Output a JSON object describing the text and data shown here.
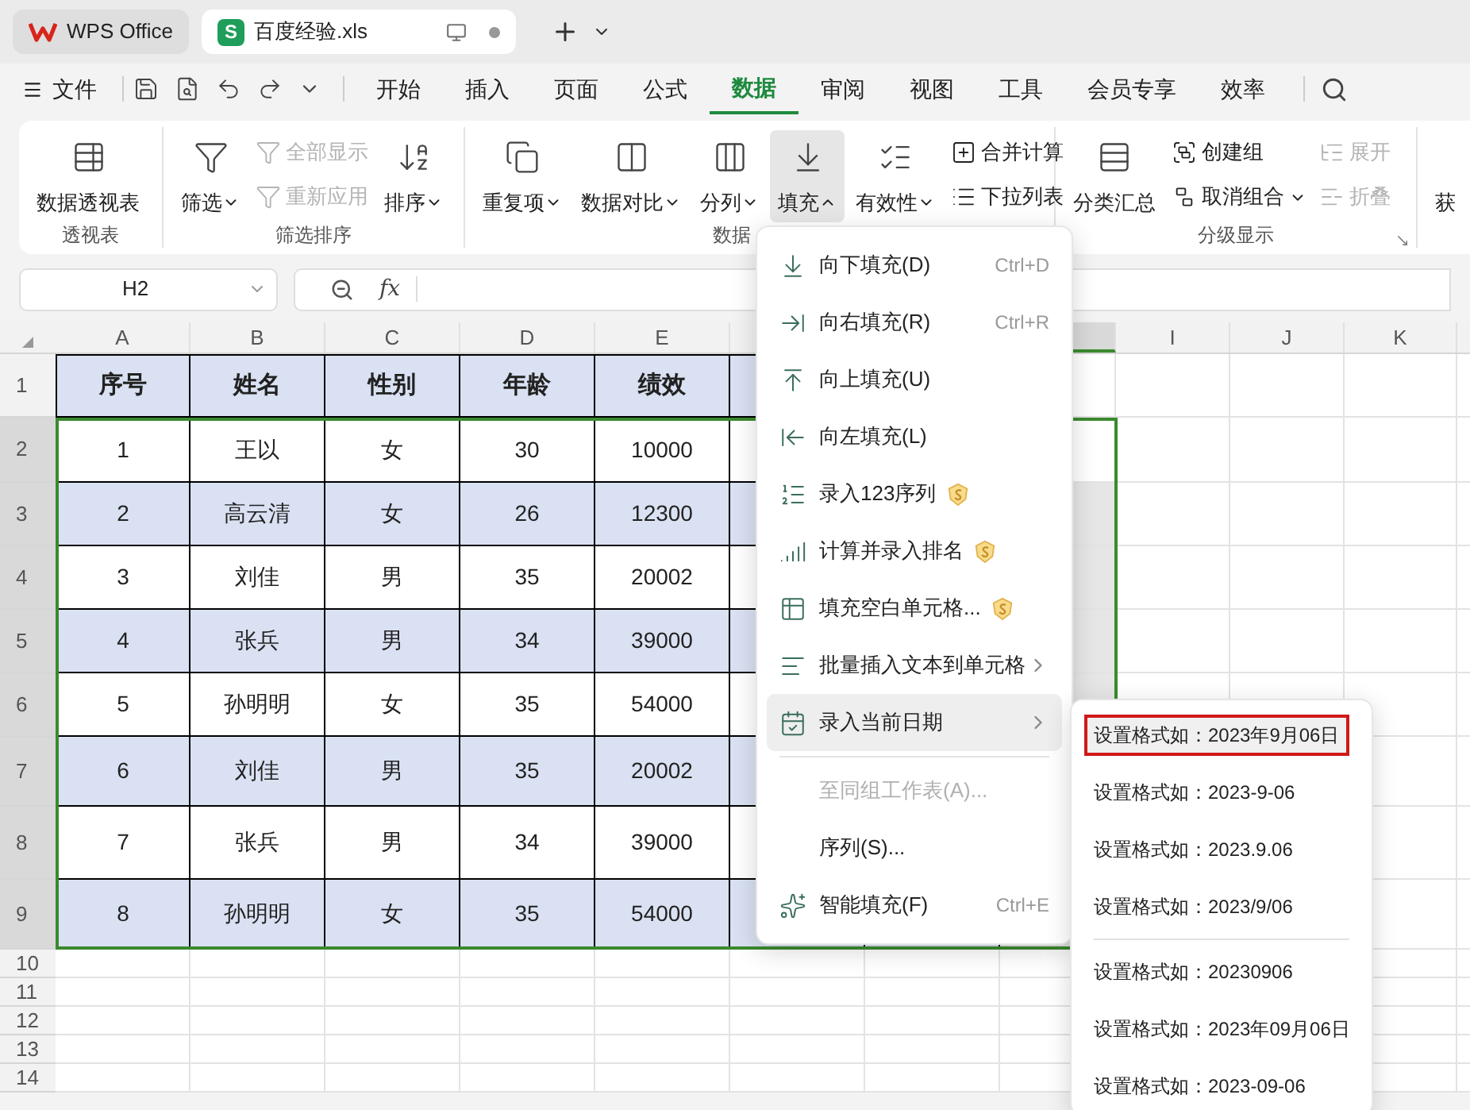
{
  "tabs": [
    {
      "label": "WPS Office",
      "kind": "home",
      "selected": false
    },
    {
      "label": "百度经验.xls",
      "kind": "sheet",
      "badge": "S",
      "selected": true
    }
  ],
  "file_menu": "文件",
  "menu_tabs": [
    {
      "label": "开始",
      "selected": false
    },
    {
      "label": "插入",
      "selected": false
    },
    {
      "label": "页面",
      "selected": false
    },
    {
      "label": "公式",
      "selected": false
    },
    {
      "label": "数据",
      "selected": true
    },
    {
      "label": "审阅",
      "selected": false
    },
    {
      "label": "视图",
      "selected": false
    },
    {
      "label": "工具",
      "selected": false
    },
    {
      "label": "会员专享",
      "selected": false
    },
    {
      "label": "效率",
      "selected": false
    }
  ],
  "ribbon": {
    "groups": [
      {
        "label": "透视表",
        "items": [
          {
            "kind": "large",
            "label": "数据透视表",
            "selected": false
          }
        ]
      },
      {
        "label": "筛选排序",
        "items": [
          {
            "kind": "large",
            "label": "筛选",
            "dropdown": true,
            "expanded": false,
            "selected": false
          },
          {
            "kind": "stack",
            "items": [
              {
                "label": "全部显示",
                "disabled": true
              },
              {
                "label": "重新应用",
                "disabled": true
              }
            ]
          },
          {
            "kind": "large",
            "label": "排序",
            "dropdown": true,
            "expanded": false,
            "selected": false
          }
        ]
      },
      {
        "label": "数据",
        "items": [
          {
            "kind": "large",
            "label": "重复项",
            "dropdown": true,
            "expanded": false,
            "selected": false
          },
          {
            "kind": "large",
            "label": "数据对比",
            "dropdown": true,
            "expanded": false,
            "selected": false
          },
          {
            "kind": "large",
            "label": "分列",
            "dropdown": true,
            "expanded": false,
            "selected": false
          },
          {
            "kind": "large",
            "label": "填充",
            "dropdown": true,
            "expanded": true,
            "selected": true
          },
          {
            "kind": "large",
            "label": "有效性",
            "dropdown": true,
            "expanded": false,
            "selected": false
          },
          {
            "kind": "stack",
            "items": [
              {
                "label": "合并计算",
                "disabled": false
              },
              {
                "label": "下拉列表",
                "disabled": false
              }
            ]
          }
        ]
      },
      {
        "label": "分级显示",
        "launcher": true,
        "items": [
          {
            "kind": "large",
            "label": "分类汇总",
            "selected": false
          },
          {
            "kind": "stack",
            "items": [
              {
                "label": "创建组",
                "disabled": false
              },
              {
                "label": "取消组合",
                "disabled": false,
                "dropdown": true,
                "expanded": false
              }
            ]
          },
          {
            "kind": "stack",
            "items": [
              {
                "label": "展开",
                "disabled": true
              },
              {
                "label": "折叠",
                "disabled": true
              }
            ]
          }
        ]
      },
      {
        "items": [
          {
            "kind": "large",
            "label": "获",
            "selected": false
          }
        ]
      }
    ]
  },
  "formula_bar": {
    "cell_ref": "H2",
    "fx": "fx"
  },
  "grid": {
    "columns": [
      {
        "label": "A",
        "selected": false
      },
      {
        "label": "B",
        "selected": false
      },
      {
        "label": "C",
        "selected": false
      },
      {
        "label": "D",
        "selected": false
      },
      {
        "label": "E",
        "selected": false
      },
      {
        "selected": true
      },
      {
        "label": "I",
        "selected": false
      },
      {
        "label": "J",
        "selected": false
      },
      {
        "label": "K",
        "selected": false
      }
    ],
    "rows": [
      {
        "label": "1",
        "selected": false,
        "cells": [
          "序号",
          "姓名",
          "性别",
          "年龄",
          "绩效"
        ]
      },
      {
        "label": "2",
        "selected": true,
        "cells": [
          "1",
          "王以",
          "女",
          "30",
          "10000"
        ]
      },
      {
        "label": "3",
        "selected": true,
        "cells": [
          "2",
          "高云清",
          "女",
          "26",
          "12300"
        ]
      },
      {
        "label": "4",
        "selected": true,
        "cells": [
          "3",
          "刘佳",
          "男",
          "35",
          "20002"
        ]
      },
      {
        "label": "5",
        "selected": true,
        "cells": [
          "4",
          "张兵",
          "男",
          "34",
          "39000"
        ]
      },
      {
        "label": "6",
        "selected": true,
        "cells": [
          "5",
          "孙明明",
          "女",
          "35",
          "54000"
        ]
      },
      {
        "label": "7",
        "selected": true,
        "cells": [
          "6",
          "刘佳",
          "男",
          "35",
          "20002"
        ]
      },
      {
        "label": "8",
        "selected": true,
        "cells": [
          "7",
          "张兵",
          "男",
          "34",
          "39000"
        ]
      },
      {
        "label": "9",
        "selected": true,
        "cells": [
          "8",
          "孙明明",
          "女",
          "35",
          "54000"
        ]
      },
      {
        "label": "10",
        "selected": false
      },
      {
        "label": "11",
        "selected": false
      },
      {
        "label": "12",
        "selected": false
      },
      {
        "label": "13",
        "selected": false
      },
      {
        "label": "14",
        "selected": false
      }
    ]
  },
  "fill_menu": [
    {
      "label": "向下填充(D)",
      "shortcut": "Ctrl+D",
      "selected": false,
      "disabled": false,
      "premium": false,
      "submenu": false
    },
    {
      "label": "向右填充(R)",
      "shortcut": "Ctrl+R",
      "selected": false,
      "disabled": false,
      "premium": false,
      "submenu": false
    },
    {
      "label": "向上填充(U)",
      "selected": false,
      "disabled": false,
      "premium": false,
      "submenu": false
    },
    {
      "label": "向左填充(L)",
      "selected": false,
      "disabled": false,
      "premium": false,
      "submenu": false
    },
    {
      "label": "录入123序列",
      "selected": false,
      "disabled": false,
      "premium": true,
      "submenu": false
    },
    {
      "label": "计算并录入排名",
      "selected": false,
      "disabled": false,
      "premium": true,
      "submenu": false
    },
    {
      "label": "填充空白单元格...",
      "selected": false,
      "disabled": false,
      "premium": true,
      "submenu": false
    },
    {
      "label": "批量插入文本到单元格",
      "selected": false,
      "disabled": false,
      "premium": false,
      "submenu": true
    },
    {
      "label": "录入当前日期",
      "selected": true,
      "disabled": false,
      "premium": false,
      "submenu": true
    },
    {
      "kind": "divider"
    },
    {
      "label": "至同组工作表(A)...",
      "selected": false,
      "disabled": true,
      "premium": false,
      "submenu": false
    },
    {
      "label": "序列(S)...",
      "selected": false,
      "disabled": false,
      "premium": false,
      "submenu": false
    },
    {
      "label": "智能填充(F)",
      "shortcut": "Ctrl+E",
      "selected": false,
      "disabled": false,
      "premium": false,
      "submenu": false
    }
  ],
  "date_submenu": [
    {
      "label": "设置格式如：2023年9月06日",
      "selected": true,
      "outlined": true
    },
    {
      "label": "设置格式如：2023-9-06",
      "selected": false,
      "outlined": false
    },
    {
      "label": "设置格式如：2023.9.06",
      "selected": false,
      "outlined": false
    },
    {
      "label": "设置格式如：2023/9/06",
      "selected": false,
      "outlined": false
    },
    {
      "kind": "divider"
    },
    {
      "label": "设置格式如：20230906",
      "selected": false,
      "outlined": false
    },
    {
      "label": "设置格式如：2023年09月06日",
      "selected": false,
      "outlined": false
    },
    {
      "label": "设置格式如：2023-09-06",
      "selected": false,
      "outlined": false
    }
  ]
}
